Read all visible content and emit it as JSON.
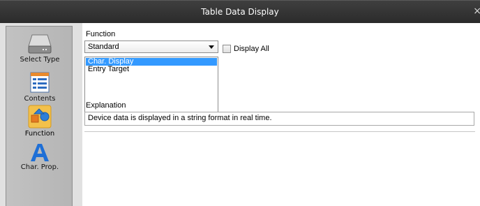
{
  "window": {
    "title": "Table Data Display",
    "close_glyph": "×"
  },
  "sidebar": {
    "items": [
      {
        "label": "Select Type",
        "icon": "drive-icon"
      },
      {
        "label": "Contents",
        "icon": "list-icon"
      },
      {
        "label": "Function",
        "icon": "shapes-icon",
        "active": true
      },
      {
        "label": "Char. Prop.",
        "icon": "letter-a-icon"
      }
    ]
  },
  "main": {
    "function_label": "Function",
    "function_select_value": "Standard",
    "display_all_label": "Display All",
    "display_all_checked": false,
    "function_list": [
      "Char. Display",
      "Entry Target"
    ],
    "selected_function_index": 0,
    "explanation_label": "Explanation",
    "explanation_text": "Device data is displayed in a string format in real time."
  },
  "colors": {
    "titlebar": "#2b2b2b",
    "selection": "#3399ff",
    "accent_blue": "#1e6fd6"
  }
}
